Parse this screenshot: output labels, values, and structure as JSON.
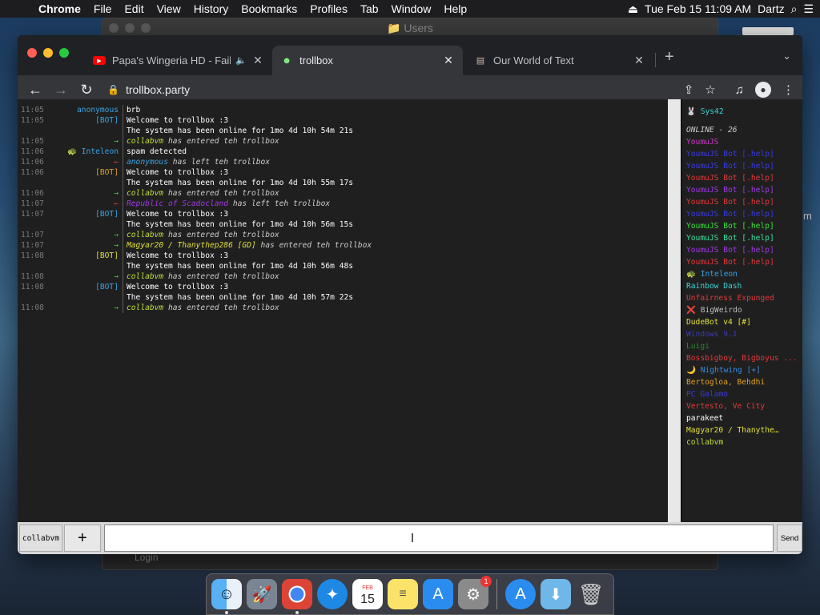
{
  "menubar": {
    "app": "Chrome",
    "items": [
      "File",
      "Edit",
      "View",
      "History",
      "Bookmarks",
      "Profiles",
      "Tab",
      "Window",
      "Help"
    ],
    "clock": "Tue Feb 15  11:09 AM",
    "user": "Dartz"
  },
  "background": {
    "window_title": "Users",
    "footer_text": "Login",
    "side_fragment": "m"
  },
  "browser": {
    "tabs": [
      {
        "title": "Papa's Wingeria HD - Fails",
        "favicon": "youtube-icon"
      },
      {
        "title": "trollbox",
        "favicon": "trollbox-icon"
      },
      {
        "title": "Our World of Text",
        "favicon": "owot-icon"
      }
    ],
    "url": "trollbox.party"
  },
  "chat": {
    "messages": [
      {
        "ts": "11:05",
        "nick": "anonymous",
        "nick_color": "#3aa3e3",
        "text": "brb",
        "sys": false,
        "text_color": "#ffffff"
      },
      {
        "ts": "11:05",
        "nick": "[BOT]",
        "nick_color": "#3aa3e3",
        "text": "Welcome to trollbox :3",
        "sys": false,
        "text_color": "#ffffff"
      },
      {
        "ts": "",
        "nick": "",
        "nick_color": "#3aa3e3",
        "text": "The system has been online for 1mo 4d 10h 54m 21s",
        "sys": false,
        "text_color": "#ffffff"
      },
      {
        "ts": "11:05",
        "nick": "→",
        "nick_color": "#3ad33a",
        "text": "collabvm",
        "sys": true,
        "suffix": " has entered teh trollbox",
        "text_color": "#bfe03a"
      },
      {
        "ts": "11:06",
        "nick": "🐢 Inteleon",
        "nick_color": "#3aa3e3",
        "text": "spam detected",
        "sys": false,
        "text_color": "#ffffff"
      },
      {
        "ts": "11:06",
        "nick": "←",
        "nick_color": "#e33a3a",
        "text": "anonymous",
        "sys": true,
        "suffix": " has left teh trollbox",
        "text_color": "#3aa3e3"
      },
      {
        "ts": "11:06",
        "nick": "[BOT]",
        "nick_color": "#e0a020",
        "text": "Welcome to trollbox :3",
        "sys": false,
        "text_color": "#ffffff"
      },
      {
        "ts": "",
        "nick": "",
        "nick_color": "#e0a020",
        "text": "The system has been online for 1mo 4d 10h 55m 17s",
        "sys": false,
        "text_color": "#ffffff"
      },
      {
        "ts": "11:06",
        "nick": "→",
        "nick_color": "#3ad33a",
        "text": "collabvm",
        "sys": true,
        "suffix": " has entered teh trollbox",
        "text_color": "#bfe03a"
      },
      {
        "ts": "11:07",
        "nick": "←",
        "nick_color": "#e33a3a",
        "text": "Republic of Scadocland",
        "sys": true,
        "suffix": " has left teh trollbox",
        "text_color": "#a03ae0"
      },
      {
        "ts": "11:07",
        "nick": "[BOT]",
        "nick_color": "#3aa3e3",
        "text": "Welcome to trollbox :3",
        "sys": false,
        "text_color": "#ffffff"
      },
      {
        "ts": "",
        "nick": "",
        "nick_color": "#3aa3e3",
        "text": "The system has been online for 1mo 4d 10h 56m 15s",
        "sys": false,
        "text_color": "#ffffff"
      },
      {
        "ts": "11:07",
        "nick": "→",
        "nick_color": "#3ad33a",
        "text": "collabvm",
        "sys": true,
        "suffix": " has entered teh trollbox",
        "text_color": "#bfe03a"
      },
      {
        "ts": "11:07",
        "nick": "→",
        "nick_color": "#3ad33a",
        "text": "Magyar20 / Thanythep286 [GD]",
        "sys": true,
        "suffix": " has entered teh trollbox",
        "text_color": "#e0e03a"
      },
      {
        "ts": "11:08",
        "nick": "[BOT]",
        "nick_color": "#e0e03a",
        "text": "Welcome to trollbox :3",
        "sys": false,
        "text_color": "#ffffff"
      },
      {
        "ts": "",
        "nick": "",
        "nick_color": "#e0e03a",
        "text": "The system has been online for 1mo 4d 10h 56m 48s",
        "sys": false,
        "text_color": "#ffffff"
      },
      {
        "ts": "11:08",
        "nick": "→",
        "nick_color": "#3ad33a",
        "text": "collabvm",
        "sys": true,
        "suffix": " has entered teh trollbox",
        "text_color": "#bfe03a"
      },
      {
        "ts": "11:08",
        "nick": "[BOT]",
        "nick_color": "#3aa3e3",
        "text": "Welcome to trollbox :3",
        "sys": false,
        "text_color": "#ffffff"
      },
      {
        "ts": "",
        "nick": "",
        "nick_color": "#3aa3e3",
        "text": "The system has been online for 1mo 4d 10h 57m 22s",
        "sys": false,
        "text_color": "#ffffff"
      },
      {
        "ts": "11:08",
        "nick": "→",
        "nick_color": "#3ad33a",
        "text": "collabvm",
        "sys": true,
        "suffix": " has entered teh trollbox",
        "text_color": "#bfe03a"
      }
    ]
  },
  "userlist": {
    "top_user": {
      "name": "🐰 Sys42",
      "color": "#3ad3d3"
    },
    "online_label": "ONLINE - 26",
    "users": [
      {
        "name": "YoumuJS",
        "color": "#c83ac8"
      },
      {
        "name": "YoumuJS Bot [.help]",
        "color": "#3a3ae0"
      },
      {
        "name": "YoumuJS Bot [.help]",
        "color": "#3a3ae0"
      },
      {
        "name": "YoumuJS Bot [.help]",
        "color": "#e03a3a"
      },
      {
        "name": "YoumuJS Bot [.help]",
        "color": "#a03ae0"
      },
      {
        "name": "YoumuJS Bot [.help]",
        "color": "#e03a3a"
      },
      {
        "name": "YoumuJS Bot [.help]",
        "color": "#3a3ae0"
      },
      {
        "name": "YoumuJS Bot [.help]",
        "color": "#3ae03a"
      },
      {
        "name": "YoumuJS Bot [.help]",
        "color": "#3ae0a0"
      },
      {
        "name": "YoumuJS Bot [.help]",
        "color": "#a03ae0"
      },
      {
        "name": "YoumuJS Bot [.help]",
        "color": "#e03a3a"
      },
      {
        "name": "🐢 Inteleon",
        "color": "#3aa3e3"
      },
      {
        "name": "Rainbow Dash",
        "color": "#3ad3d3"
      },
      {
        "name": "Unfairness Expunged",
        "color": "#e03a3a"
      },
      {
        "name": "❌ BigWeirdo",
        "color": "#bbbbbb"
      },
      {
        "name": "DudeBot v4 [#]",
        "color": "#e0e03a"
      },
      {
        "name": "Windows 9.1",
        "color": "#3a3ab0"
      },
      {
        "name": "Luigi",
        "color": "#2a8a2a"
      },
      {
        "name": "Bossbigboy, Bigboyus ...",
        "color": "#e03a3a"
      },
      {
        "name": "🌙 Nightwing [+]",
        "color": "#3a8ae0"
      },
      {
        "name": "Bertogloa, Behdhi",
        "color": "#e0a020"
      },
      {
        "name": "PC Galamo",
        "color": "#3a3ae0"
      },
      {
        "name": "Vertesto, Ve City",
        "color": "#e03a3a"
      },
      {
        "name": "parakeet",
        "color": "#ffffff"
      },
      {
        "name": "Magyar20 / Thanythe…",
        "color": "#e0e03a"
      },
      {
        "name": "collabvm",
        "color": "#bfe03a"
      }
    ]
  },
  "input_bar": {
    "nick_button": "collabvm",
    "plus_label": "+",
    "input_value": "",
    "send_label": "Send"
  },
  "dock": {
    "apps": [
      "finder-icon",
      "launchpad-icon",
      "chrome-icon",
      "safari-icon",
      "calendar-icon",
      "notes-icon",
      "appstore-icon",
      "systempreferences-icon",
      "appstore2-icon",
      "downloads-icon",
      "trash-icon"
    ],
    "calendar_day": "15",
    "calendar_month": "FEB",
    "prefs_badge": "1"
  }
}
